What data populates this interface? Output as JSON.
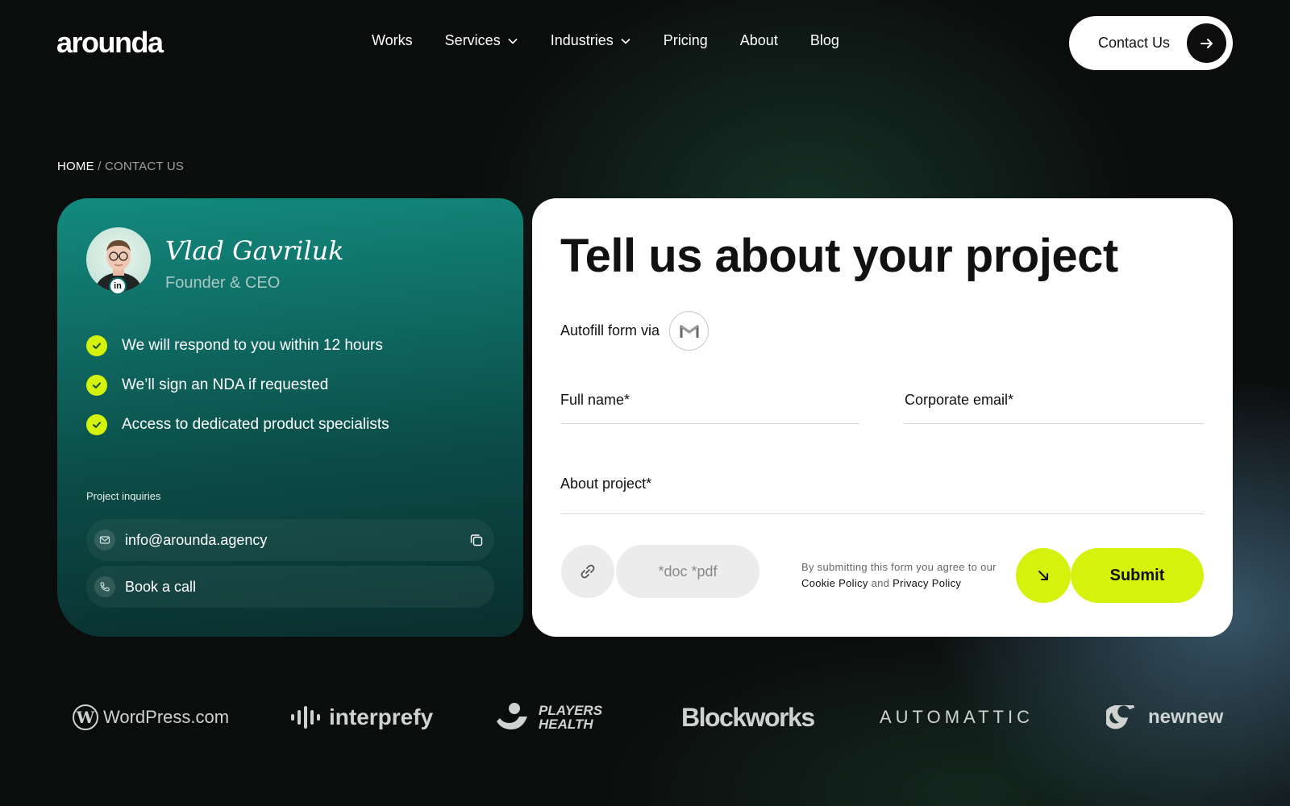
{
  "nav": {
    "logo": "arounda",
    "items": [
      {
        "label": "Works",
        "dropdown": false
      },
      {
        "label": "Services",
        "dropdown": true
      },
      {
        "label": "Industries",
        "dropdown": true
      },
      {
        "label": "Pricing",
        "dropdown": false
      },
      {
        "label": "About",
        "dropdown": false
      },
      {
        "label": "Blog",
        "dropdown": false
      }
    ],
    "contact_label": "Contact Us",
    "contact_icon": "arrow-right-icon"
  },
  "breadcrumb": {
    "home": "HOME",
    "separator": "/",
    "current": "CONTACT US"
  },
  "person": {
    "name": "Vlad Gavriluk",
    "role": "Founder & CEO",
    "badge": "in"
  },
  "benefits": [
    "We will respond to you within 12 hours",
    "We’ll sign an NDA if requested",
    "Access to dedicated product specialists"
  ],
  "inquiries": {
    "label": "Project inquiries",
    "email": "info@arounda.agency",
    "call": "Book a call"
  },
  "form": {
    "title": "Tell us about your project",
    "autofill_label": "Autofill form via",
    "autofill_icon": "gmail-icon",
    "full_name_label": "Full name*",
    "email_label": "Corporate email*",
    "project_label": "About project*",
    "full_name_value": "",
    "email_value": "",
    "project_value": "",
    "file_types": "*doc  *pdf",
    "consent_prefix": "By submitting this form you agree to our",
    "cookie_policy": "Cookie Policy",
    "consent_and": "and",
    "privacy_policy": "Privacy Policy",
    "submit_label": "Submit"
  },
  "clients": {
    "wordpress": "WordPress.com",
    "interprefy": "interprefy",
    "players_line1": "PLAYERS",
    "players_line2": "HEALTH",
    "blockworks": "Blockworks",
    "automattic": "AUTOMATTIC",
    "newnew": "newnew"
  },
  "colors": {
    "accent": "#d4f20b",
    "card_teal": "#0f6b63",
    "background": "#0b0c0c"
  }
}
